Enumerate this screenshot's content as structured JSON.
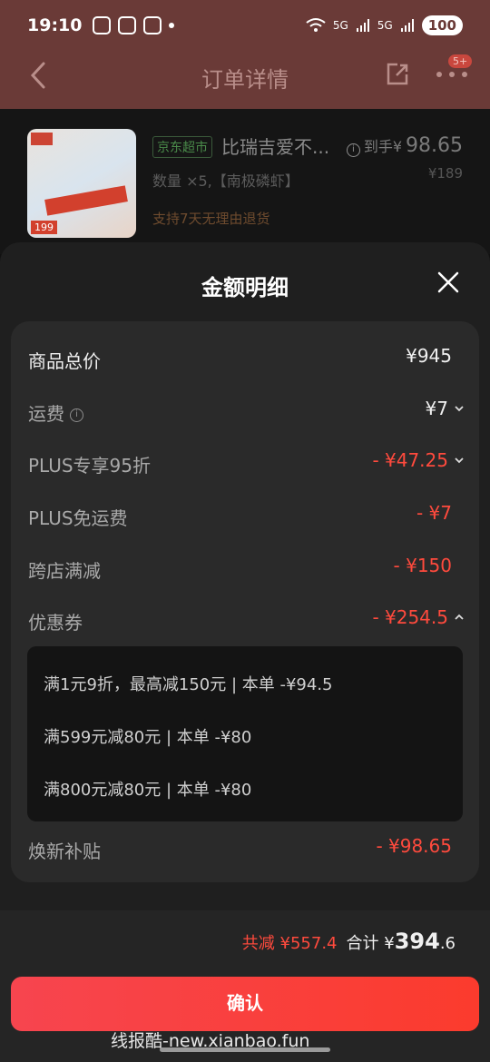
{
  "status": {
    "time": "19:10",
    "battery": "100",
    "net1": "5G",
    "net2": "5G"
  },
  "header": {
    "title": "订单详情",
    "badge": "5+"
  },
  "product": {
    "tag": "京东超市",
    "name": "比瑞吉爱不...",
    "qty": "数量 ×5,【南极磷虾】",
    "service": "支持7天无理由退货",
    "price_prefix": "到手¥",
    "price": "98.65",
    "orig_price": "¥189",
    "thumb_price": "199"
  },
  "sheet": {
    "title": "金额明细",
    "rows": [
      {
        "label": "商品总价",
        "value": "¥945"
      },
      {
        "label": "运费",
        "value": "¥7"
      },
      {
        "label": "PLUS专享95折",
        "value": "- ¥47.25"
      },
      {
        "label": "PLUS免运费",
        "value": "- ¥7"
      },
      {
        "label": "跨店满减",
        "value": "- ¥150"
      },
      {
        "label": "优惠券",
        "value": "- ¥254.5"
      },
      {
        "label": "焕新补贴",
        "value": "- ¥98.65"
      }
    ],
    "coupons": [
      "满1元9折，最高减150元 | 本单 -¥94.5",
      "满599元减80元 | 本单 -¥80",
      "满800元减80元 | 本单 -¥80"
    ]
  },
  "footer": {
    "saved": "共减 ¥557.4",
    "total_label": "合计 ¥",
    "total_int": "394",
    "total_dec": ".6",
    "confirm": "确认",
    "watermark": "线报酷-new.xianbao.fun"
  },
  "colors": {
    "accent": "#ff4a3d",
    "header_bg": "#6a3a37",
    "sheet_bg": "#1f1f1f"
  }
}
